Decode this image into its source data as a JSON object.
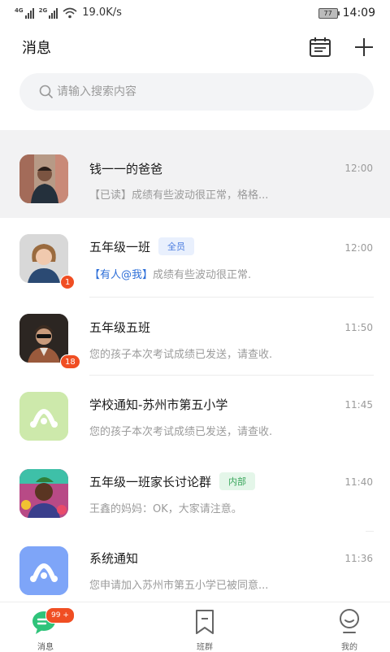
{
  "status_bar": {
    "net1": "4G",
    "net2": "2G",
    "speed": "19.0K/s",
    "battery": "77",
    "time": "14:09"
  },
  "header": {
    "title": "消息"
  },
  "search": {
    "placeholder": "请输入搜索内容"
  },
  "conversations": [
    {
      "name": "钱一一的爸爸",
      "time": "12:00",
      "preview_prefix": "【已读】",
      "preview": "成绩有些波动很正常，格格..."
    },
    {
      "name": "五年级一班",
      "tag": "全员",
      "time": "12:00",
      "preview_prefix": "【有人@我】",
      "preview": "成绩有些波动很正常.",
      "badge": "1"
    },
    {
      "name": "五年级五班",
      "time": "11:50",
      "preview": "您的孩子本次考试成绩已发送，请查收.",
      "badge": "18"
    },
    {
      "name": "学校通知-苏州市第五小学",
      "time": "11:45",
      "preview": "您的孩子本次考试成绩已发送，请查收."
    },
    {
      "name": "五年级一班家长讨论群",
      "tag": "内部",
      "time": "11:40",
      "preview": "王鑫的妈妈：OK，大家请注意。"
    },
    {
      "name": "系统通知",
      "time": "11:36",
      "preview": "您申请加入苏州市第五小学已被同意..."
    }
  ],
  "tabs": [
    {
      "label": "消息",
      "badge": "99 +"
    },
    {
      "label": "班群"
    },
    {
      "label": "我的"
    }
  ],
  "colors": {
    "accent_green": "#2fc37a",
    "badge_red": "#f04e23",
    "notice_green": "#cde9ab",
    "notice_blue": "#7ea5f8"
  }
}
